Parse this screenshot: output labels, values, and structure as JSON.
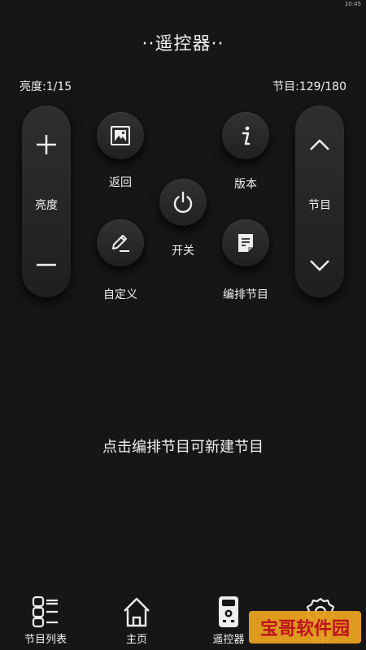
{
  "status_time": "10:45",
  "title": "··遥控器··",
  "brightness_readout": "亮度:1/15",
  "channel_readout": "节目:129/180",
  "brightness_pill": {
    "label": "亮度",
    "up_icon": "plus-icon",
    "down_icon": "minus-icon"
  },
  "channel_pill": {
    "label": "节目",
    "up_icon": "chevron-up-icon",
    "down_icon": "chevron-down-icon"
  },
  "buttons": {
    "back": "返回",
    "power": "开关",
    "version": "版本",
    "custom": "自定义",
    "edit_program": "编排节目"
  },
  "hint": "点击编排节目可新建节目",
  "tabs": [
    {
      "label": "节目列表",
      "icon": "grid-list-icon"
    },
    {
      "label": "主页",
      "icon": "home-icon"
    },
    {
      "label": "遥控器",
      "icon": "remote-icon",
      "active": true
    },
    {
      "label": "设置",
      "icon": "gear-icon"
    }
  ],
  "watermark": "宝哥软件园",
  "colors": {
    "background": "#161616",
    "text": "#f2f2f2",
    "watermark_bg": "#e9a21f",
    "watermark_text": "#c8101c"
  }
}
